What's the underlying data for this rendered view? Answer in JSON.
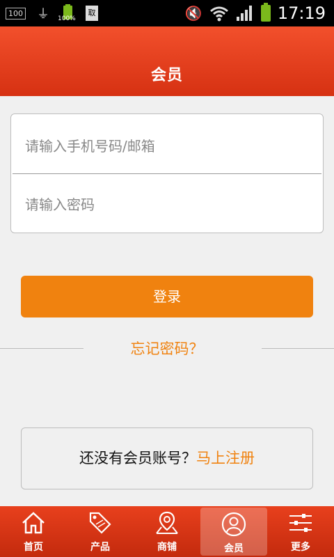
{
  "status_bar": {
    "notification_count": "100",
    "time": "17:19",
    "battery_percent": "100%",
    "doc_glyph": "取"
  },
  "header": {
    "title": "会员"
  },
  "login": {
    "phone_placeholder": "请输入手机号码/邮箱",
    "password_placeholder": "请输入密码",
    "submit_label": "登录",
    "forgot_label": "忘记密码？"
  },
  "register": {
    "question": "还没有会员账号？",
    "link_label": "马上注册"
  },
  "nav": {
    "items": [
      {
        "label": "首页",
        "icon": "home-icon"
      },
      {
        "label": "产品",
        "icon": "sale-tag-icon"
      },
      {
        "label": "商铺",
        "icon": "map-pin-icon"
      },
      {
        "label": "会员",
        "icon": "user-icon",
        "active": true
      },
      {
        "label": "更多",
        "icon": "sliders-icon"
      }
    ]
  },
  "colors": {
    "header": "#e8401d",
    "accent": "#f0820f"
  }
}
